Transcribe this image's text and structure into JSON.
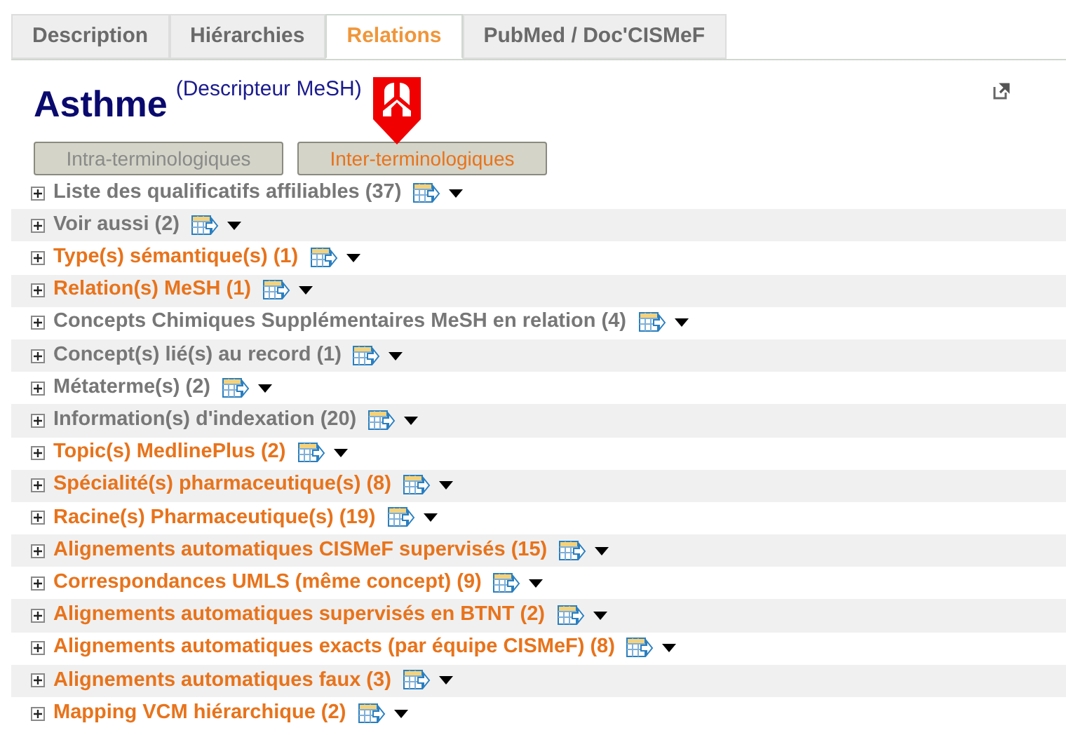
{
  "tabs": [
    {
      "label": "Description",
      "selected": false
    },
    {
      "label": "Hiérarchies",
      "selected": false
    },
    {
      "label": "Relations",
      "selected": true
    },
    {
      "label": "PubMed / Doc'CISMeF",
      "selected": false
    }
  ],
  "heading": {
    "title": "Asthme",
    "subtitle": "(Descripteur MeSH)"
  },
  "toggle_buttons": [
    {
      "label": "Intra-terminologiques",
      "selected": false
    },
    {
      "label": "Inter-terminologiques",
      "selected": true
    }
  ],
  "sections": [
    {
      "label": "Liste des qualificatifs affiliables (37)",
      "color": "#777777"
    },
    {
      "label": "Voir aussi (2)",
      "color": "#777777"
    },
    {
      "label": "Type(s) sémantique(s) (1)",
      "color": "#e8731b"
    },
    {
      "label": "Relation(s) MeSH (1)",
      "color": "#e8731b"
    },
    {
      "label": "Concepts Chimiques Supplémentaires MeSH en relation (4)",
      "color": "#777777"
    },
    {
      "label": "Concept(s) lié(s) au record (1)",
      "color": "#777777"
    },
    {
      "label": "Métaterme(s) (2)",
      "color": "#777777"
    },
    {
      "label": "Information(s) d'indexation (20)",
      "color": "#777777"
    },
    {
      "label": "Topic(s) MedlinePlus (2)",
      "color": "#e8731b"
    },
    {
      "label": "Spécialité(s) pharmaceutique(s) (8)",
      "color": "#e8731b"
    },
    {
      "label": "Racine(s) Pharmaceutique(s) (19)",
      "color": "#e8731b"
    },
    {
      "label": "Alignements automatiques CISMeF supervisés (15)",
      "color": "#e8731b"
    },
    {
      "label": "Correspondances UMLS (même concept) (9)",
      "color": "#e8731b"
    },
    {
      "label": "Alignements automatiques supervisés en BTNT (2)",
      "color": "#e8731b"
    },
    {
      "label": "Alignements automatiques exacts (par équipe CISMeF) (8)",
      "color": "#e8731b"
    },
    {
      "label": "Alignements automatiques faux (3)",
      "color": "#e8731b"
    },
    {
      "label": "Mapping VCM hiérarchique (2)",
      "color": "#e8731b"
    }
  ]
}
